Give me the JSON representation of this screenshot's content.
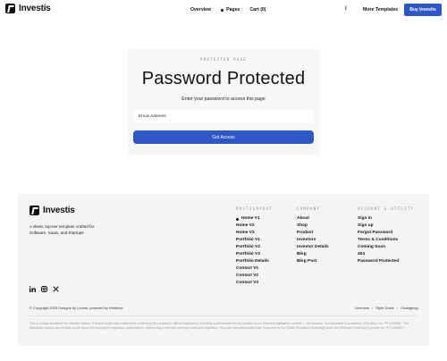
{
  "header": {
    "logo_text": "Investis",
    "nav": {
      "overview": "Overview",
      "pages": "Pages",
      "cart": "Cart (0)"
    },
    "info_glyph": "i",
    "more_templates": "More Templates",
    "buy_button": "Buy Investis",
    "accent_color": "#2d57c5"
  },
  "main": {
    "eyebrow": "PROTECTED PAGE",
    "title": "Password Protected",
    "subtitle": "Enter your password to access this page",
    "password_placeholder": "Email Address",
    "submit_label": "Get Access"
  },
  "footer": {
    "logo_text": "Investis",
    "tagline": "A sleek, top-tier template crafted for Software, SaaS, and Startups",
    "socials": [
      "linkedin-icon",
      "instagram-icon",
      "x-icon"
    ],
    "columns": [
      {
        "heading": "MULTILAYOUT",
        "items": [
          "Home V1",
          "Home V2",
          "Home V3",
          "Portfolio V1",
          "Portfolio V2",
          "Portfolio V3",
          "Portfolio Details",
          "Contact V1",
          "Contact V2",
          "Contact V3"
        ],
        "active_index": 0
      },
      {
        "heading": "COMPANY",
        "items": [
          "About",
          "Shop",
          "Product",
          "Investors",
          "Investor Details",
          "Blog",
          "Blog Post"
        ]
      },
      {
        "heading": "ACCOUNT & UTILITY",
        "items": [
          "Sign in",
          "Sign up",
          "Forgot Password",
          "Terms & Conditions",
          "Coming Soon",
          "404",
          "Password Protected"
        ]
      }
    ],
    "copyright": "© Copyright 2025 Designs by Lunnis; powered by Webflow",
    "legal_links": [
      "Licenses",
      "Style Guide",
      "Changelog"
    ],
    "disclaimer": "This is a legal disclaimer for website visitors. It should begin with a statement confirming the company's official registration, including a placeholder for the location and a relevant registration number — for instance, \"Incorporated in [Location], USA (Reg. No. PY-123456).\" The disclaimer should also include a note about the company's regulatory authorization, referencing a relevant oversight body and regulation. You may use placeholders like \"Licensed by the [State Regulatory Authority] under the [Relevant State Act] (License No. PY-123456).\""
  }
}
